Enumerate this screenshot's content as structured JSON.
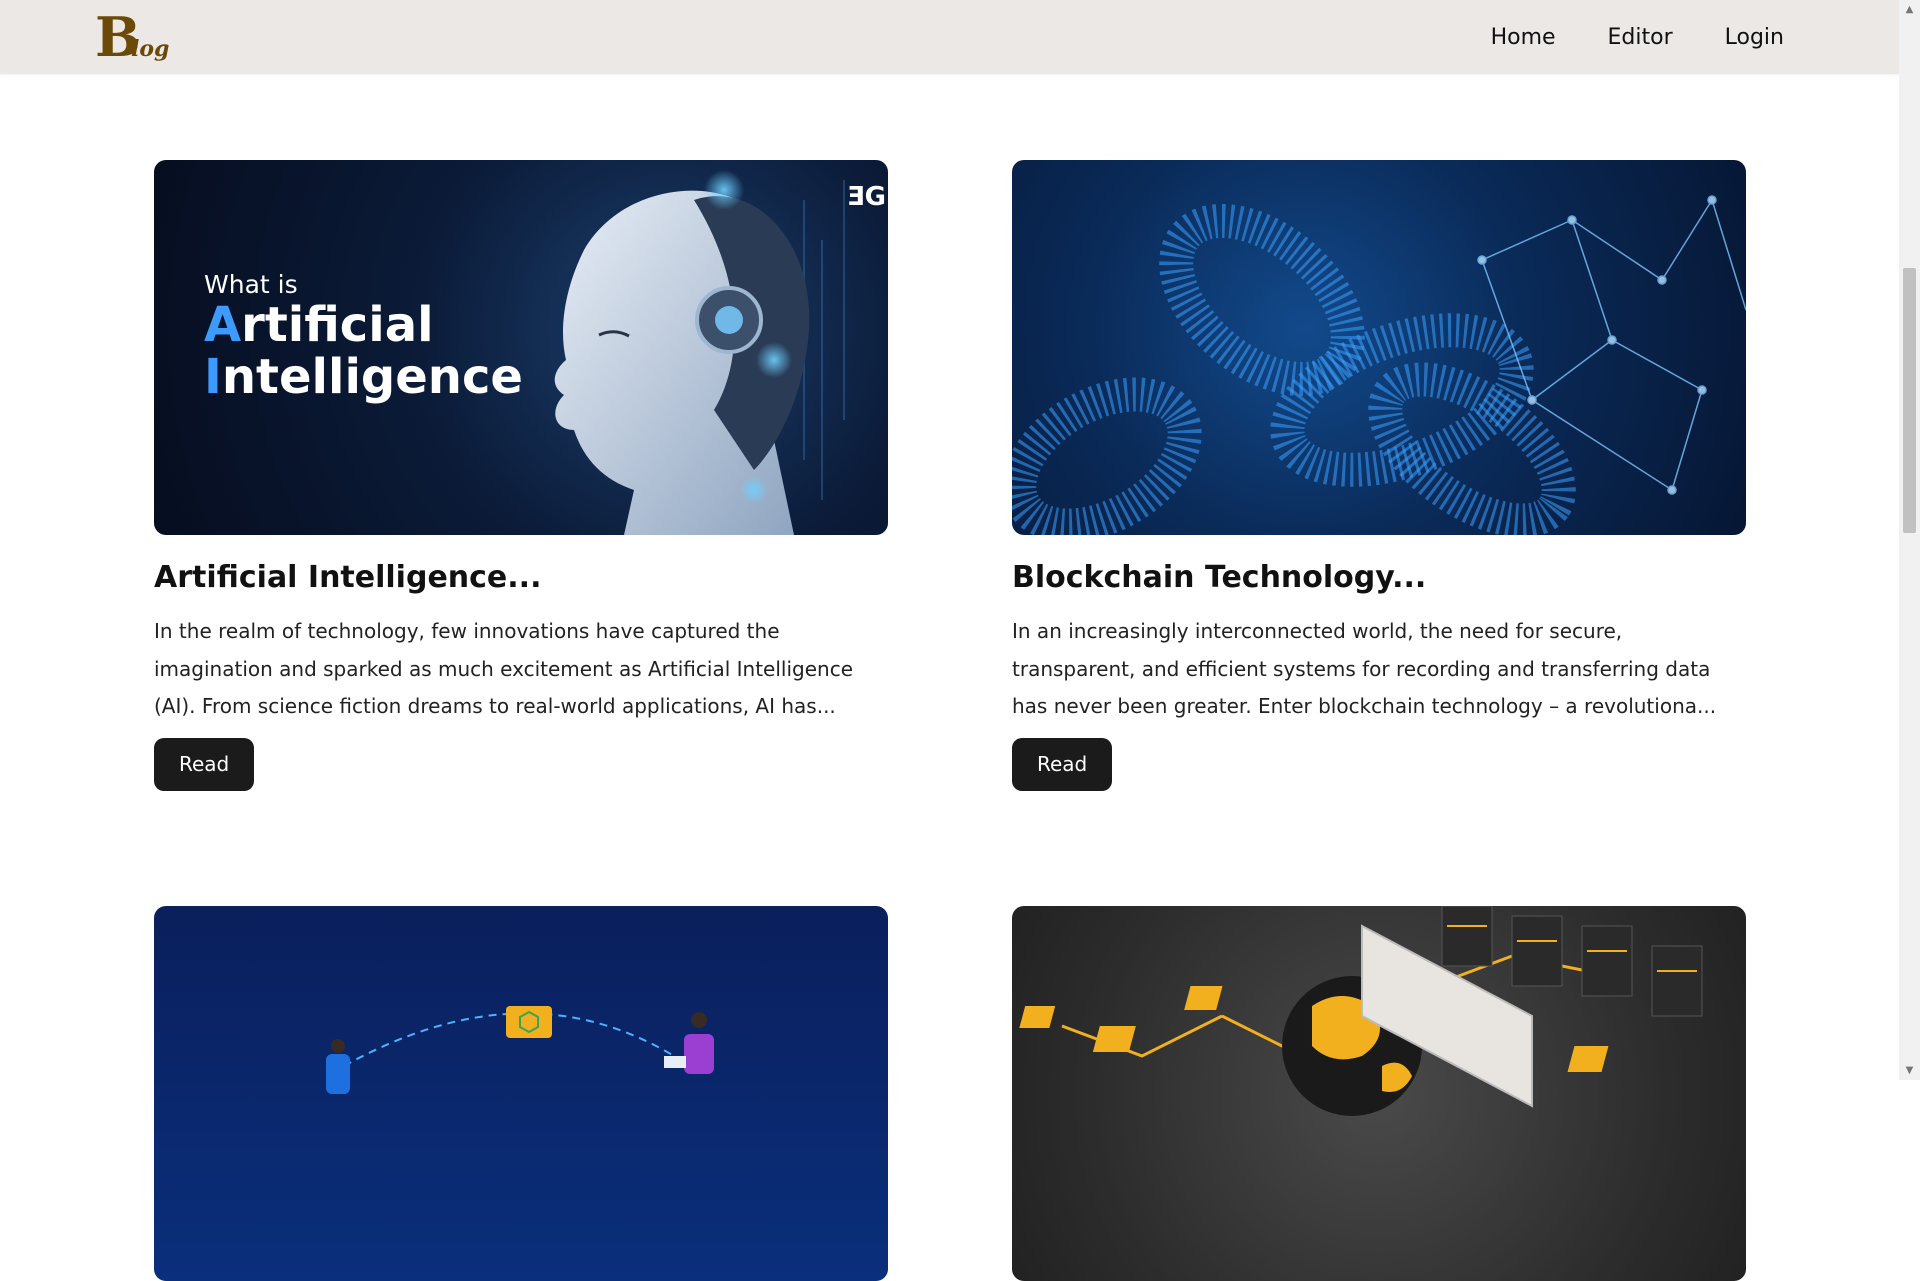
{
  "header": {
    "logo_big": "B",
    "logo_small": "log",
    "nav": [
      "Home",
      "Editor",
      "Login"
    ]
  },
  "posts": [
    {
      "image_text": {
        "line1": "What is",
        "line2_accent": "A",
        "line2_rest": "rtificial",
        "line3_accent": "I",
        "line3_rest": "ntelligence",
        "badge": "ƎG"
      },
      "title": "Artificial Intelligence...",
      "excerpt": "In the realm of technology, few innovations have captured the imagination and sparked as much excitement as Artificial Intelligence (AI). From science fiction dreams to real-world applications, AI has...",
      "button": "Read"
    },
    {
      "title": "Blockchain Technology...",
      "excerpt": "In an increasingly interconnected world, the need for secure, transparent, and efficient systems for recording and transferring data has never been greater. Enter blockchain technology – a revolutiona...",
      "button": "Read"
    }
  ],
  "colors": {
    "header_bg": "#ece8e6",
    "logo": "#6b4a07",
    "button_bg": "#1b1b1b",
    "ai_accent": "#3d9bff"
  },
  "icons": {
    "scroll_up": "scroll-up-arrow-icon",
    "scroll_down": "scroll-down-arrow-icon"
  }
}
